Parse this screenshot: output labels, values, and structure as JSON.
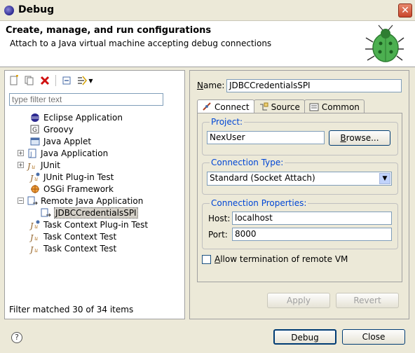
{
  "window": {
    "title": "Debug",
    "close_glyph": "✕"
  },
  "header": {
    "title": "Create, manage, and run configurations",
    "subtitle": "Attach to a Java virtual machine accepting debug connections",
    "icon": "bug-icon"
  },
  "left": {
    "filter_placeholder": "type filter text",
    "tree": [
      {
        "label": "Eclipse Application",
        "icon": "eclipse-icon",
        "expander": ""
      },
      {
        "label": "Groovy",
        "icon": "groovy-icon",
        "expander": ""
      },
      {
        "label": "Java Applet",
        "icon": "applet-icon",
        "expander": ""
      },
      {
        "label": "Java Application",
        "icon": "java-app-icon",
        "expander": "+"
      },
      {
        "label": "JUnit",
        "icon": "junit-icon",
        "expander": "+"
      },
      {
        "label": "JUnit Plug-in Test",
        "icon": "junit-plugin-icon",
        "expander": ""
      },
      {
        "label": "OSGi Framework",
        "icon": "osgi-icon",
        "expander": ""
      },
      {
        "label": "Remote Java Application",
        "icon": "remote-java-icon",
        "expander": "−"
      },
      {
        "label": "JDBCCredentialsSPI",
        "icon": "remote-config-icon",
        "expander": ""
      },
      {
        "label": "Task Context Plug-in Test",
        "icon": "task-plugin-icon",
        "expander": ""
      },
      {
        "label": "Task Context Test",
        "icon": "task-test-icon",
        "expander": ""
      },
      {
        "label": "Task Context Test",
        "icon": "task-test-icon",
        "expander": ""
      }
    ],
    "filter_status": "Filter matched 30 of 34 items"
  },
  "right": {
    "name_label_u": "N",
    "name_label_rest": "ame:",
    "name_value": "JDBCCredentialsSPI",
    "tabs": [
      {
        "label": "Connect",
        "icon": "connect-icon"
      },
      {
        "label": "Source",
        "icon": "source-icon"
      },
      {
        "label": "Common",
        "icon": "common-icon"
      }
    ],
    "project": {
      "legend": "Project:",
      "value": "NexUser",
      "browse_u": "B",
      "browse_rest": "rowse..."
    },
    "connection_type": {
      "legend": "Connection Type:",
      "selected": "Standard (Socket Attach)"
    },
    "connection_props": {
      "legend": "Connection Properties:",
      "host_label": "Host:",
      "host_value": "localhost",
      "port_label": "Port:",
      "port_value": "8000"
    },
    "allow_termination": {
      "label_u": "A",
      "label_rest": "llow termination of remote VM",
      "checked": false
    },
    "apply_label": "Apply",
    "revert_label": "Revert"
  },
  "footer": {
    "help_glyph": "?",
    "debug_label": "Debug",
    "close_label": "Close"
  }
}
